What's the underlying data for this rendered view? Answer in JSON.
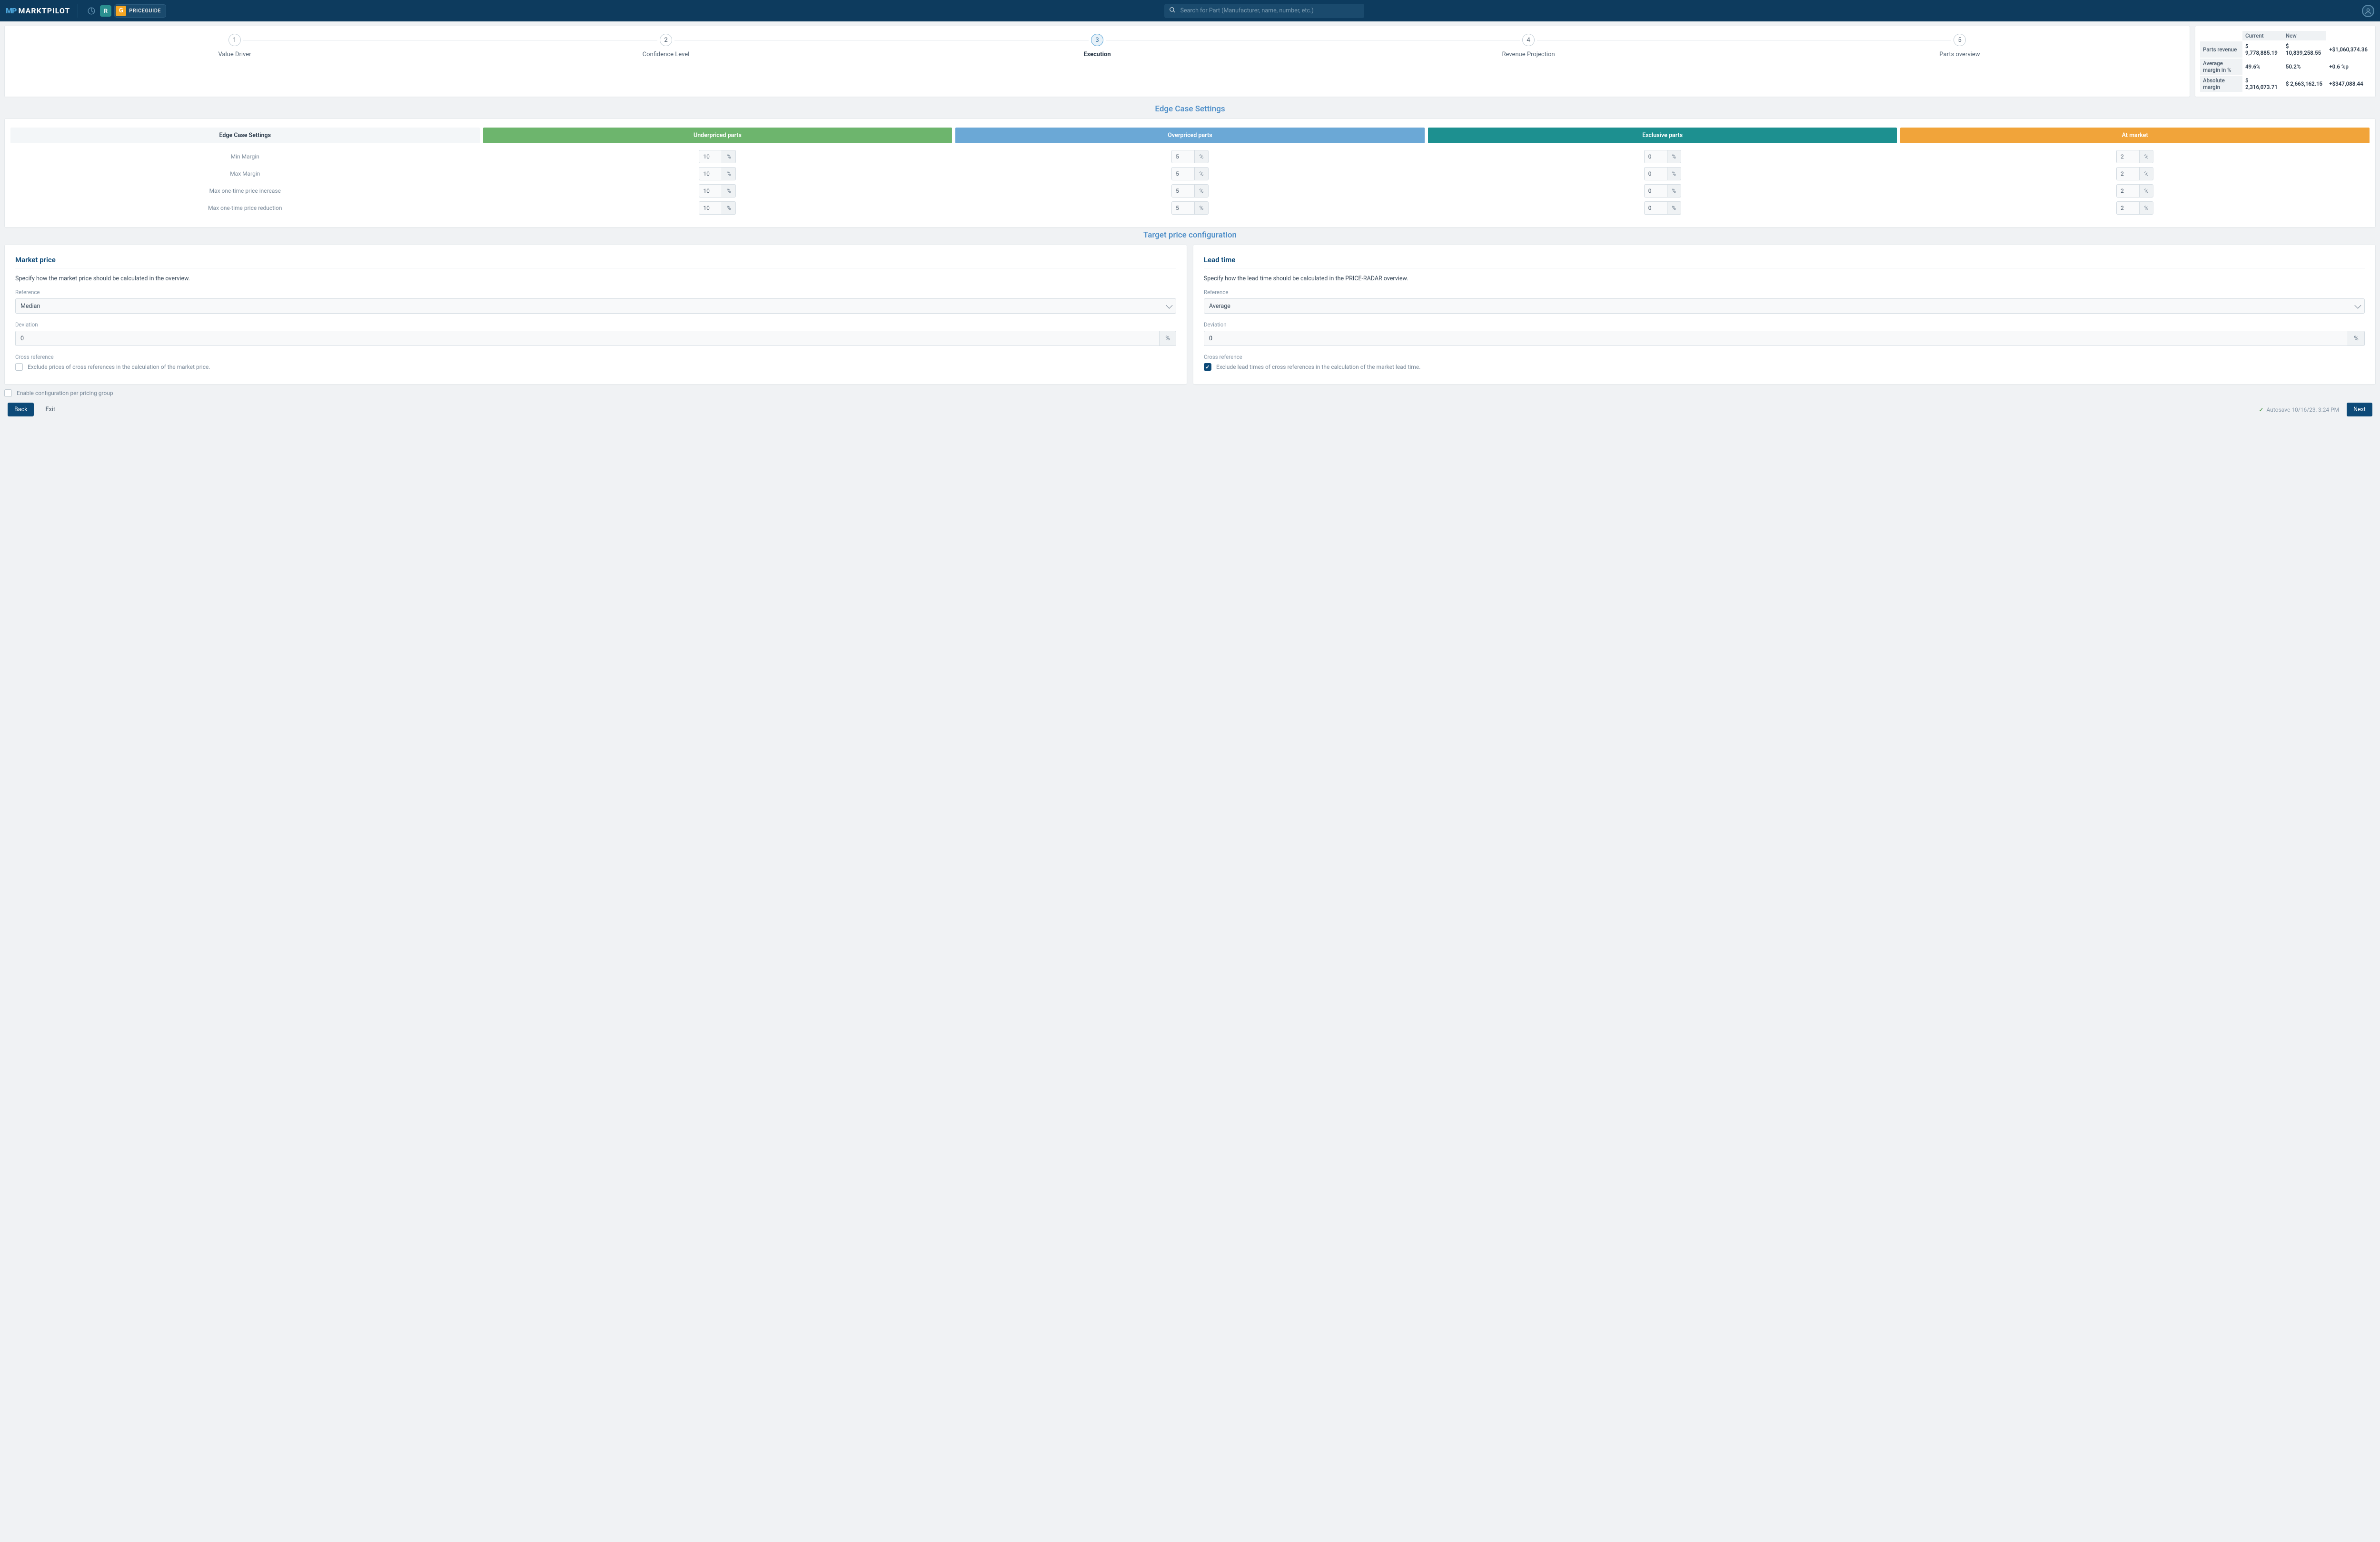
{
  "header": {
    "logo_prefix": "MP",
    "logo_text": "MARKTPILOT",
    "priceguide_g": "G",
    "priceguide_text": "PRICEGUIDE",
    "r_icon": "R",
    "search_placeholder": "Search for Part (Manufacturer, name, number, etc.)"
  },
  "steps": [
    {
      "num": "1",
      "label": "Value Driver"
    },
    {
      "num": "2",
      "label": "Confidence Level"
    },
    {
      "num": "3",
      "label": "Execution"
    },
    {
      "num": "4",
      "label": "Revenue Projection"
    },
    {
      "num": "5",
      "label": "Parts overview"
    }
  ],
  "metrics": {
    "h_current": "Current",
    "h_new": "New",
    "rows": [
      {
        "label": "Parts revenue",
        "current": "$ 9,778,885.19",
        "new": "$ 10,839,258.55",
        "delta": "+$1,060,374.36"
      },
      {
        "label": "Average margin in %",
        "current": "49.6%",
        "new": "50.2%",
        "delta": "+0.6 %p"
      },
      {
        "label": "Absolute margin",
        "current": "$ 2,316,073.71",
        "new": "$ 2,663,162.15",
        "delta": "+$347,088.44"
      }
    ]
  },
  "edge": {
    "title": "Edge Case Settings",
    "header_label": "Edge Case Settings",
    "columns": [
      "Underpriced parts",
      "Overpriced parts",
      "Exclusive parts",
      "At market"
    ],
    "rows": [
      {
        "label": "Min Margin",
        "vals": [
          "10",
          "5",
          "0",
          "2"
        ]
      },
      {
        "label": "Max Margin",
        "vals": [
          "10",
          "5",
          "0",
          "2"
        ]
      },
      {
        "label": "Max one-time price increase",
        "vals": [
          "10",
          "5",
          "0",
          "2"
        ]
      },
      {
        "label": "Max one-time price reduction",
        "vals": [
          "10",
          "5",
          "0",
          "2"
        ]
      }
    ],
    "unit": "%"
  },
  "target": {
    "title": "Target price configuration",
    "market": {
      "title": "Market price",
      "desc": "Specify how the market price should be calculated in the overview.",
      "reference_label": "Reference",
      "reference_value": "Median",
      "deviation_label": "Deviation",
      "deviation_value": "0",
      "cross_label": "Cross reference",
      "check_label": "Exclude prices of cross references in the calculation of the market price.",
      "checked": false
    },
    "lead": {
      "title": "Lead time",
      "desc": "Specify how the lead time should be calculated in the PRICE-RADAR overview.",
      "reference_label": "Reference",
      "reference_value": "Average",
      "deviation_label": "Deviation",
      "deviation_value": "0",
      "cross_label": "Cross reference",
      "check_label": "Exclude lead times of cross references in the calculation of the market lead time.",
      "checked": true
    }
  },
  "global_check_label": "Enable configuration per pricing group",
  "footer": {
    "back": "Back",
    "exit": "Exit",
    "next": "Next",
    "autosave": "Autosave 10/16/23, 3:24 PM"
  }
}
